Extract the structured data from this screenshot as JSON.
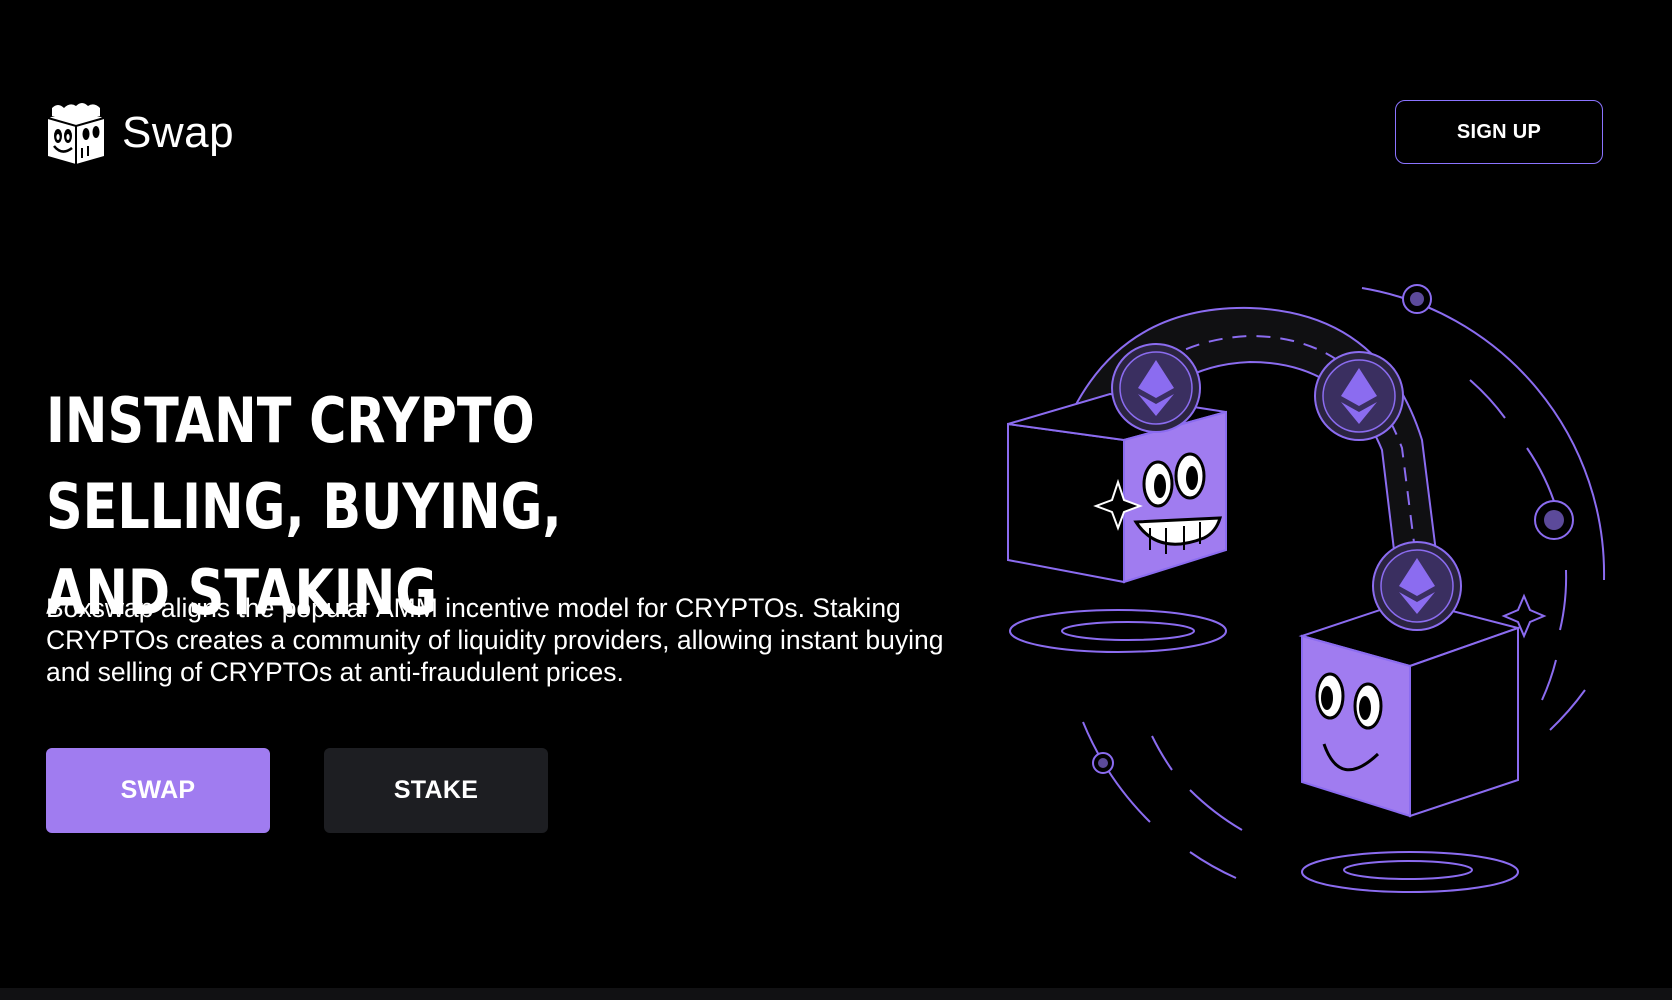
{
  "header": {
    "logo_text": "Swap",
    "signup_label": "SIGN UP"
  },
  "hero": {
    "title_line1": "INSTANT CRYPTO SELLING, BUYING,",
    "title_line2": "AND STAKING",
    "description": "Boxswap aligns the popular AMM incentive model for CRYPTOs. Staking CRYPTOs creates a community of liquidity providers, allowing instant buying and selling of CRYPTOs at anti-fraudulent prices.",
    "swap_label": "SWAP",
    "stake_label": "STAKE"
  },
  "colors": {
    "background": "#000000",
    "accent": "#a07cf0",
    "stake_button": "#1d1e22",
    "outline": "#8b74ff"
  },
  "icons": {
    "logo": "box-logo-icon",
    "coin": "ethereum-icon",
    "illustration": "crypto-boxes-illustration"
  }
}
